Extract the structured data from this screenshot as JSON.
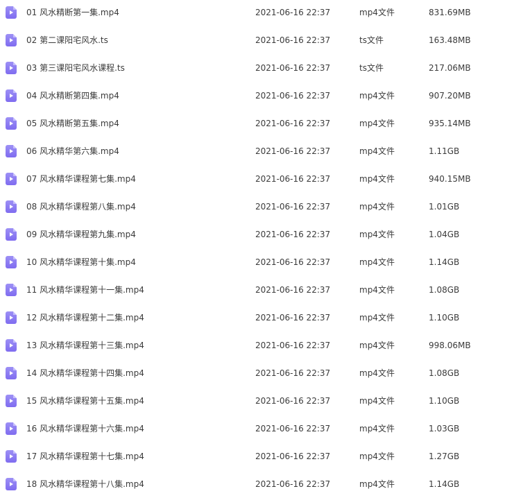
{
  "files": [
    {
      "name": "01 风水精断第一集.mp4",
      "modified": "2021-06-16 22:37",
      "type": "mp4文件",
      "size": "831.69MB",
      "icon": "video-file-icon"
    },
    {
      "name": "02 第二课阳宅风水.ts",
      "modified": "2021-06-16 22:37",
      "type": "ts文件",
      "size": "163.48MB",
      "icon": "video-file-icon"
    },
    {
      "name": "03 第三课阳宅风水课程.ts",
      "modified": "2021-06-16 22:37",
      "type": "ts文件",
      "size": "217.06MB",
      "icon": "video-file-icon"
    },
    {
      "name": "04 风水精断第四集.mp4",
      "modified": "2021-06-16 22:37",
      "type": "mp4文件",
      "size": "907.20MB",
      "icon": "video-file-icon"
    },
    {
      "name": "05 风水精断第五集.mp4",
      "modified": "2021-06-16 22:37",
      "type": "mp4文件",
      "size": "935.14MB",
      "icon": "video-file-icon"
    },
    {
      "name": "06 风水精华第六集.mp4",
      "modified": "2021-06-16 22:37",
      "type": "mp4文件",
      "size": "1.11GB",
      "icon": "video-file-icon"
    },
    {
      "name": "07 风水精华课程第七集.mp4",
      "modified": "2021-06-16 22:37",
      "type": "mp4文件",
      "size": "940.15MB",
      "icon": "video-file-icon"
    },
    {
      "name": "08 风水精华课程第八集.mp4",
      "modified": "2021-06-16 22:37",
      "type": "mp4文件",
      "size": "1.01GB",
      "icon": "video-file-icon"
    },
    {
      "name": "09 风水精华课程第九集.mp4",
      "modified": "2021-06-16 22:37",
      "type": "mp4文件",
      "size": "1.04GB",
      "icon": "video-file-icon"
    },
    {
      "name": "10 风水精华课程第十集.mp4",
      "modified": "2021-06-16 22:37",
      "type": "mp4文件",
      "size": "1.14GB",
      "icon": "video-file-icon"
    },
    {
      "name": "11 风水精华课程第十一集.mp4",
      "modified": "2021-06-16 22:37",
      "type": "mp4文件",
      "size": "1.08GB",
      "icon": "video-file-icon"
    },
    {
      "name": "12 风水精华课程第十二集.mp4",
      "modified": "2021-06-16 22:37",
      "type": "mp4文件",
      "size": "1.10GB",
      "icon": "video-file-icon"
    },
    {
      "name": "13 风水精华课程第十三集.mp4",
      "modified": "2021-06-16 22:37",
      "type": "mp4文件",
      "size": "998.06MB",
      "icon": "video-file-icon"
    },
    {
      "name": "14 风水精华课程第十四集.mp4",
      "modified": "2021-06-16 22:37",
      "type": "mp4文件",
      "size": "1.08GB",
      "icon": "video-file-icon"
    },
    {
      "name": "15 风水精华课程第十五集.mp4",
      "modified": "2021-06-16 22:37",
      "type": "mp4文件",
      "size": "1.10GB",
      "icon": "video-file-icon"
    },
    {
      "name": "16 风水精华课程第十六集.mp4",
      "modified": "2021-06-16 22:37",
      "type": "mp4文件",
      "size": "1.03GB",
      "icon": "video-file-icon"
    },
    {
      "name": "17 风水精华课程第十七集.mp4",
      "modified": "2021-06-16 22:37",
      "type": "mp4文件",
      "size": "1.27GB",
      "icon": "video-file-icon"
    },
    {
      "name": "18 风水精华课程第十八集.mp4",
      "modified": "2021-06-16 22:37",
      "type": "mp4文件",
      "size": "1.14GB",
      "icon": "video-file-icon"
    }
  ],
  "colors": {
    "icon_purple": "#8b7cf2",
    "text": "#3b3b3b"
  }
}
